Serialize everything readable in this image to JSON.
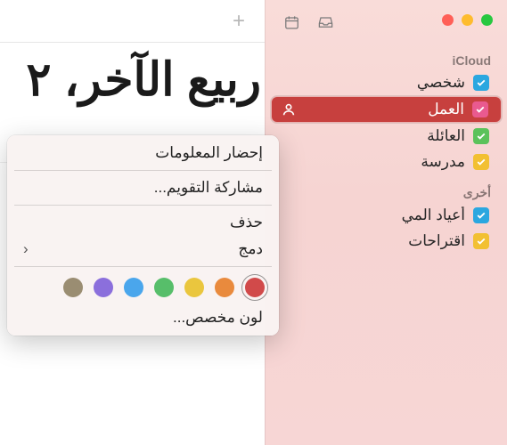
{
  "sidebar": {
    "section1": "iCloud",
    "section2": "أخرى",
    "items": [
      {
        "label": "شخصي",
        "color": "#2aa7e0"
      },
      {
        "label": "العمل",
        "color": "#e95a8f"
      },
      {
        "label": "العائلة",
        "color": "#5bc25b"
      },
      {
        "label": "مدرسة",
        "color": "#f2c032"
      }
    ],
    "other": [
      {
        "label": "أعياد المي",
        "color": "#2aa7e0"
      },
      {
        "label": "اقتراحات",
        "color": "#f2c032"
      }
    ]
  },
  "main": {
    "title": "ربيع الآخر، ٢"
  },
  "menu": {
    "getInfo": "إحضار المعلومات",
    "share": "مشاركة التقويم...",
    "delete": "حذف",
    "merge": "دمج",
    "custom": "لون مخصص...",
    "colors": [
      "#d14a4a",
      "#e98a3d",
      "#eac63e",
      "#57be6a",
      "#4aa6ec",
      "#8b6fdc",
      "#9a8d72"
    ]
  }
}
